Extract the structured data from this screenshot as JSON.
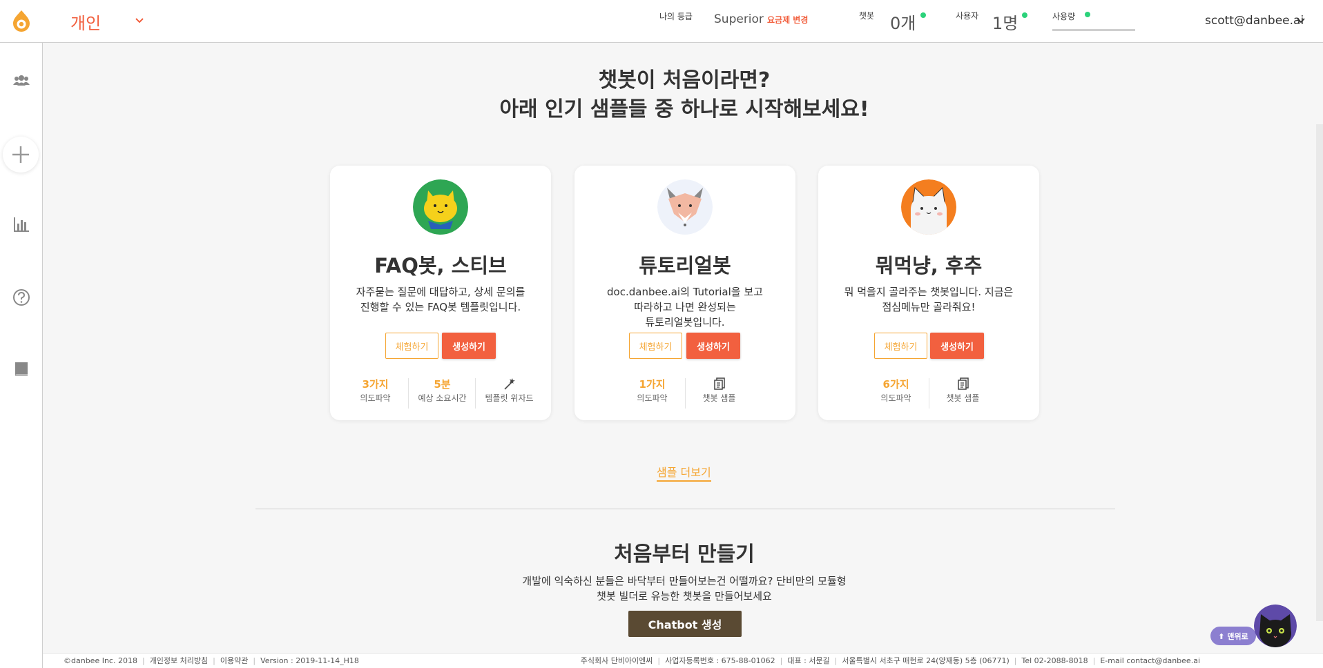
{
  "header": {
    "workspace": "개인",
    "grade_label": "나의 등급",
    "grade_value": "Superior",
    "change_plan": "요금제 변경",
    "chatbot_label": "챗봇",
    "chatbot_value": "0개",
    "users_label": "사용자",
    "users_value": "1명",
    "usage_label": "사용량",
    "user_email": "scott@danbee.ai",
    "status_color": "#2bd27a",
    "accent_color": "#f2603f"
  },
  "sidebar": {
    "icons": [
      "people-icon",
      "plus-icon",
      "bar-chart-icon",
      "help-icon",
      "book-icon"
    ]
  },
  "intro": {
    "line1": "챗봇이 처음이라면?",
    "line2": "아래 인기 샘플들 중 하나로 시작해보세요!"
  },
  "cards": [
    {
      "name": "FAQ봇, 스티브",
      "desc_line1": "자주묻는 질문에 대답하고, 상세 문의를",
      "desc_line2": "진행할 수 있는 FAQ봇 템플릿입니다.",
      "desc_line3": "",
      "try_label": "체험하기",
      "make_label": "생성하기",
      "stats": [
        {
          "value": "3가지",
          "label": "의도파악"
        },
        {
          "value": "5분",
          "label": "예상 소요시간"
        },
        {
          "icon": "magic-wand-icon",
          "label": "템플릿 위자드"
        }
      ]
    },
    {
      "name": "튜토리얼봇",
      "desc_line1": "doc.danbee.ai의 Tutorial을 보고",
      "desc_line2": "따라하고 나면 완성되는",
      "desc_line3": "튜토리얼봇입니다.",
      "try_label": "체험하기",
      "make_label": "생성하기",
      "stats": [
        {
          "value": "1가지",
          "label": "의도파악"
        },
        {
          "icon": "document-icon",
          "label": "챗봇 샘플"
        }
      ]
    },
    {
      "name": "뭐먹냥, 후추",
      "desc_line1": "뭐 먹을지 골라주는 챗봇입니다. 지금은",
      "desc_line2": "점심메뉴만 골라줘요!",
      "desc_line3": "",
      "try_label": "체험하기",
      "make_label": "생성하기",
      "stats": [
        {
          "value": "6가지",
          "label": "의도파악"
        },
        {
          "icon": "document-icon",
          "label": "챗봇 샘플"
        }
      ]
    }
  ],
  "more_samples": "샘플 더보기",
  "scratch": {
    "title": "처음부터 만들기",
    "desc_line1": "개발에 익숙하신 분들은 바닥부터 만들어보는건 어떨까요? 단비만의 모듈형",
    "desc_line2": "챗봇 빌더로 유능한 챗봇을 만들어보세요",
    "button": "Chatbot 생성"
  },
  "footer": {
    "copyright": "©danbee Inc. 2018",
    "privacy": "개인정보 처리방침",
    "terms": "이용약관",
    "version": "Version : 2019-11-14_H18",
    "company": "주식회사 단비아이엔씨",
    "biz_no": "사업자등록번호 : 675-88-01062",
    "ceo": "대표 : 서문길",
    "address": "서울특별시 서초구 매헌로 24(양재동) 5층 (06771)",
    "tel": "Tel 02-2088-8018",
    "email": "E-mail contact@danbee.ai"
  },
  "top_button": "⬆ 맨위로"
}
